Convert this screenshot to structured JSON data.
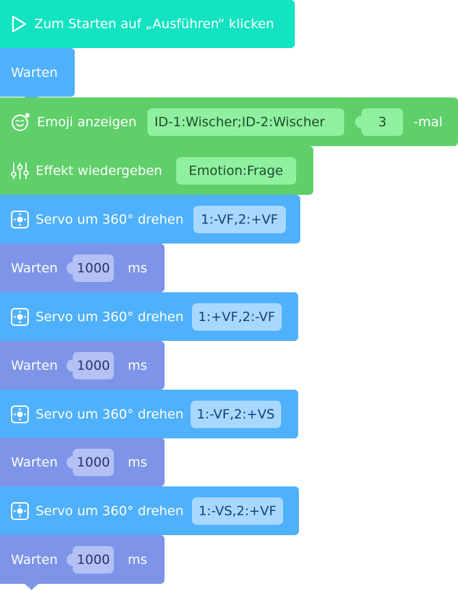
{
  "blocks": {
    "start": {
      "label": "Zum Starten auf „Ausführen“ klicken"
    },
    "wait1": {
      "label": "Warten"
    },
    "emoji": {
      "label": "Emoji anzeigen",
      "value": "ID-1:Wischer;ID-2:Wischer",
      "count": "3",
      "suffix": "-mal"
    },
    "effect": {
      "label": "Effekt wiedergeben",
      "value": "Emotion:Frage"
    },
    "servo1": {
      "label": "Servo um 360° drehen",
      "value": "1:-VF,2:+VF"
    },
    "wait2": {
      "label": "Warten",
      "value": "1000",
      "unit": "ms"
    },
    "servo2": {
      "label": "Servo um 360° drehen",
      "value": "1:+VF,2:-VF"
    },
    "wait3": {
      "label": "Warten",
      "value": "1000",
      "unit": "ms"
    },
    "servo3": {
      "label": "Servo um 360° drehen",
      "value": "1:-VF,2:+VS"
    },
    "wait4": {
      "label": "Warten",
      "value": "1000",
      "unit": "ms"
    },
    "servo4": {
      "label": "Servo um 360° drehen",
      "value": "1:-VS,2:+VF"
    },
    "wait5": {
      "label": "Warten",
      "value": "1000",
      "unit": "ms"
    }
  },
  "icons": {
    "start": "play-icon",
    "emoji": "emoji-face-icon",
    "effect": "equalizer-sliders-icon",
    "servo": "servo-motor-icon"
  },
  "colors": {
    "start": "#12e3c0",
    "control": "#4fb0fb",
    "looks": "#5fcf6a",
    "motion": "#4fb0fb",
    "wait_ms": "#7d94e8"
  }
}
